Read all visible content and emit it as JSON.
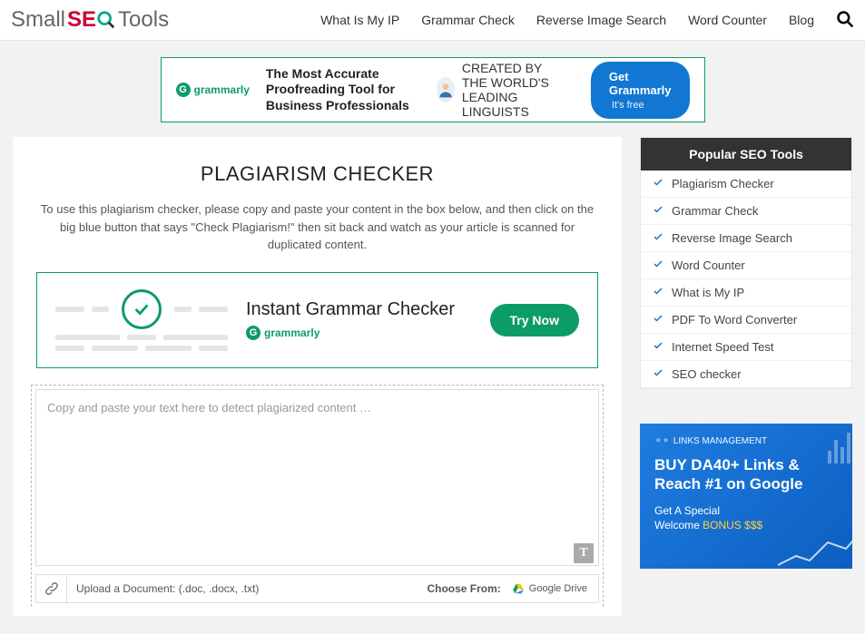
{
  "header": {
    "logo_small": "Small",
    "logo_seo_s": "S",
    "logo_seo_e": "E",
    "logo_tools": "Tools",
    "nav": [
      "What Is My IP",
      "Grammar Check",
      "Reverse Image Search",
      "Word Counter",
      "Blog"
    ]
  },
  "banner1": {
    "brand": "grammarly",
    "headline": "The Most Accurate Proofreading Tool for Business Professionals",
    "created_by": "CREATED BY",
    "linguists": "THE WORLD'S LEADING LINGUISTS",
    "button": "Get Grammarly",
    "button_extra": "It's free"
  },
  "main": {
    "title": "PLAGIARISM CHECKER",
    "subtitle": "To use this plagiarism checker, please copy and paste your content in the box below, and then click on the big blue button that says \"Check Plagiarism!\" then sit back and watch as your article is scanned for duplicated content.",
    "banner2_title": "Instant Grammar Checker",
    "banner2_brand": "grammarly",
    "try_now": "Try Now",
    "placeholder": "Copy and paste your text here to detect plagiarized content …",
    "upload_text": "Upload a Document: (.doc, .docx, .txt)",
    "choose_from": "Choose From:",
    "gdrive": "Google Drive"
  },
  "sidebar": {
    "header": "Popular SEO Tools",
    "items": [
      "Plagiarism Checker",
      "Grammar Check",
      "Reverse Image Search",
      "Word Counter",
      "What is My IP",
      "PDF To Word Converter",
      "Internet Speed Test",
      "SEO checker"
    ]
  },
  "promo": {
    "brand": "LINKS MANAGEMENT",
    "title": "BUY DA40+ Links & Reach #1 on Google",
    "sub1": "Get A Special",
    "sub2": "Welcome ",
    "bonus": "BONUS $$$"
  }
}
